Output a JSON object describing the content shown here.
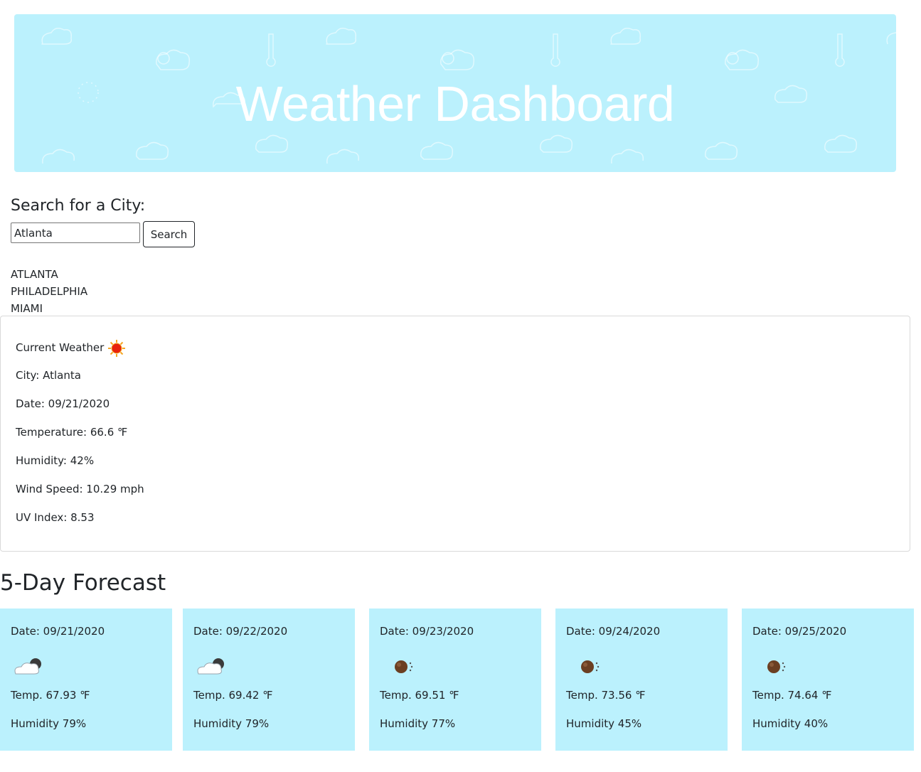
{
  "header": {
    "title": "Weather Dashboard"
  },
  "search": {
    "heading": "Search for a City:",
    "input_value": "Atlanta",
    "button_label": "Search"
  },
  "history": [
    "ATLANTA",
    "PHILADELPHIA",
    "MIAMI"
  ],
  "current": {
    "title": "Current Weather",
    "icon": "sun-icon",
    "city": "City: Atlanta",
    "date": "Date: 09/21/2020",
    "temperature": "Temperature: 66.6 ℉",
    "humidity": "Humidity: 42%",
    "wind": "Wind Speed: 10.29 mph",
    "uv": "UV Index: 8.53"
  },
  "forecast": {
    "heading": "5-Day Forecast",
    "days": [
      {
        "date": "Date: 09/21/2020",
        "icon": "cloud-moon-icon",
        "temp": "Temp. 67.93 ℉",
        "humidity": "Humidity 79%"
      },
      {
        "date": "Date: 09/22/2020",
        "icon": "cloud-moon-icon",
        "temp": "Temp. 69.42 ℉",
        "humidity": "Humidity 79%"
      },
      {
        "date": "Date: 09/23/2020",
        "icon": "moon-icon",
        "temp": "Temp. 69.51 ℉",
        "humidity": "Humidity 77%"
      },
      {
        "date": "Date: 09/24/2020",
        "icon": "moon-icon",
        "temp": "Temp. 73.56 ℉",
        "humidity": "Humidity 45%"
      },
      {
        "date": "Date: 09/25/2020",
        "icon": "moon-icon",
        "temp": "Temp. 74.64 ℉",
        "humidity": "Humidity 40%"
      }
    ]
  },
  "colors": {
    "banner": "#bbf1fd",
    "card": "#bbf1fd",
    "text": "#212529"
  }
}
